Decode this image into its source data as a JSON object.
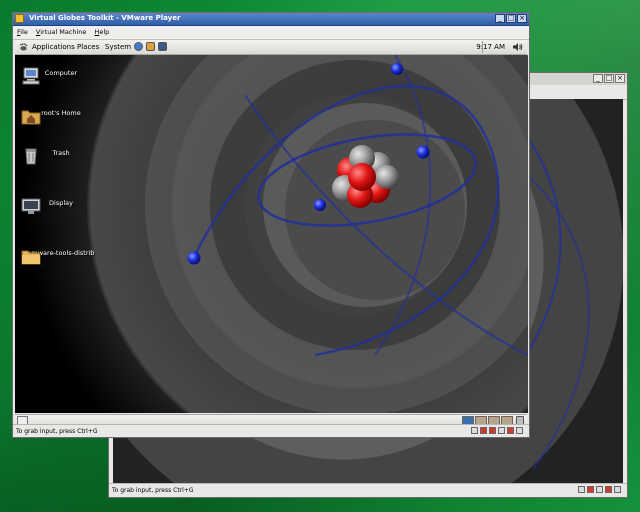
{
  "vm_window": {
    "title": "Virtual Globes Toolkit - VMware Player",
    "menus": [
      "File",
      "Virtual Machine",
      "Help"
    ],
    "controls": {
      "minimize": "_",
      "maximize": "□",
      "close": "×"
    },
    "status_text": "To grab input, press Ctrl+G"
  },
  "guest_panel": {
    "menus": [
      "Applications",
      "Places",
      "System"
    ],
    "launchers": [
      "browser-icon",
      "mail-icon",
      "help-icon"
    ],
    "clock": "9:17 AM",
    "volume_icon": "speaker-icon"
  },
  "desktop_icons": [
    {
      "label": "Computer",
      "icon": "computer-icon"
    },
    {
      "label": "root's Home",
      "icon": "home-folder-icon"
    },
    {
      "label": "Trash",
      "icon": "trash-icon"
    },
    {
      "label": "Display",
      "icon": "display-icon"
    },
    {
      "label": "vmware-tools-distrib",
      "icon": "folder-icon"
    }
  ],
  "bottom_panel": {
    "workspaces": [
      {
        "active": true,
        "color": "#3a6fb0"
      },
      {
        "active": false,
        "color": "#b8a48c"
      },
      {
        "active": false,
        "color": "#b8a48c"
      },
      {
        "active": false,
        "color": "#b8a48c"
      },
      {
        "active": false,
        "color": "#b8a48c"
      }
    ]
  },
  "back_window": {
    "controls": {
      "minimize": "_",
      "maximize": "□",
      "close": "×"
    },
    "status_text": "To grab input, press Ctrl+G"
  },
  "colors": {
    "host_desktop": "#11933a",
    "title_active": "#2f5fa8",
    "nucleus_red": "#e21515",
    "nucleus_gray": "#9a9a9a",
    "electron_blue": "#1c2fe0",
    "orbit_blue": "#1f2f9e"
  }
}
